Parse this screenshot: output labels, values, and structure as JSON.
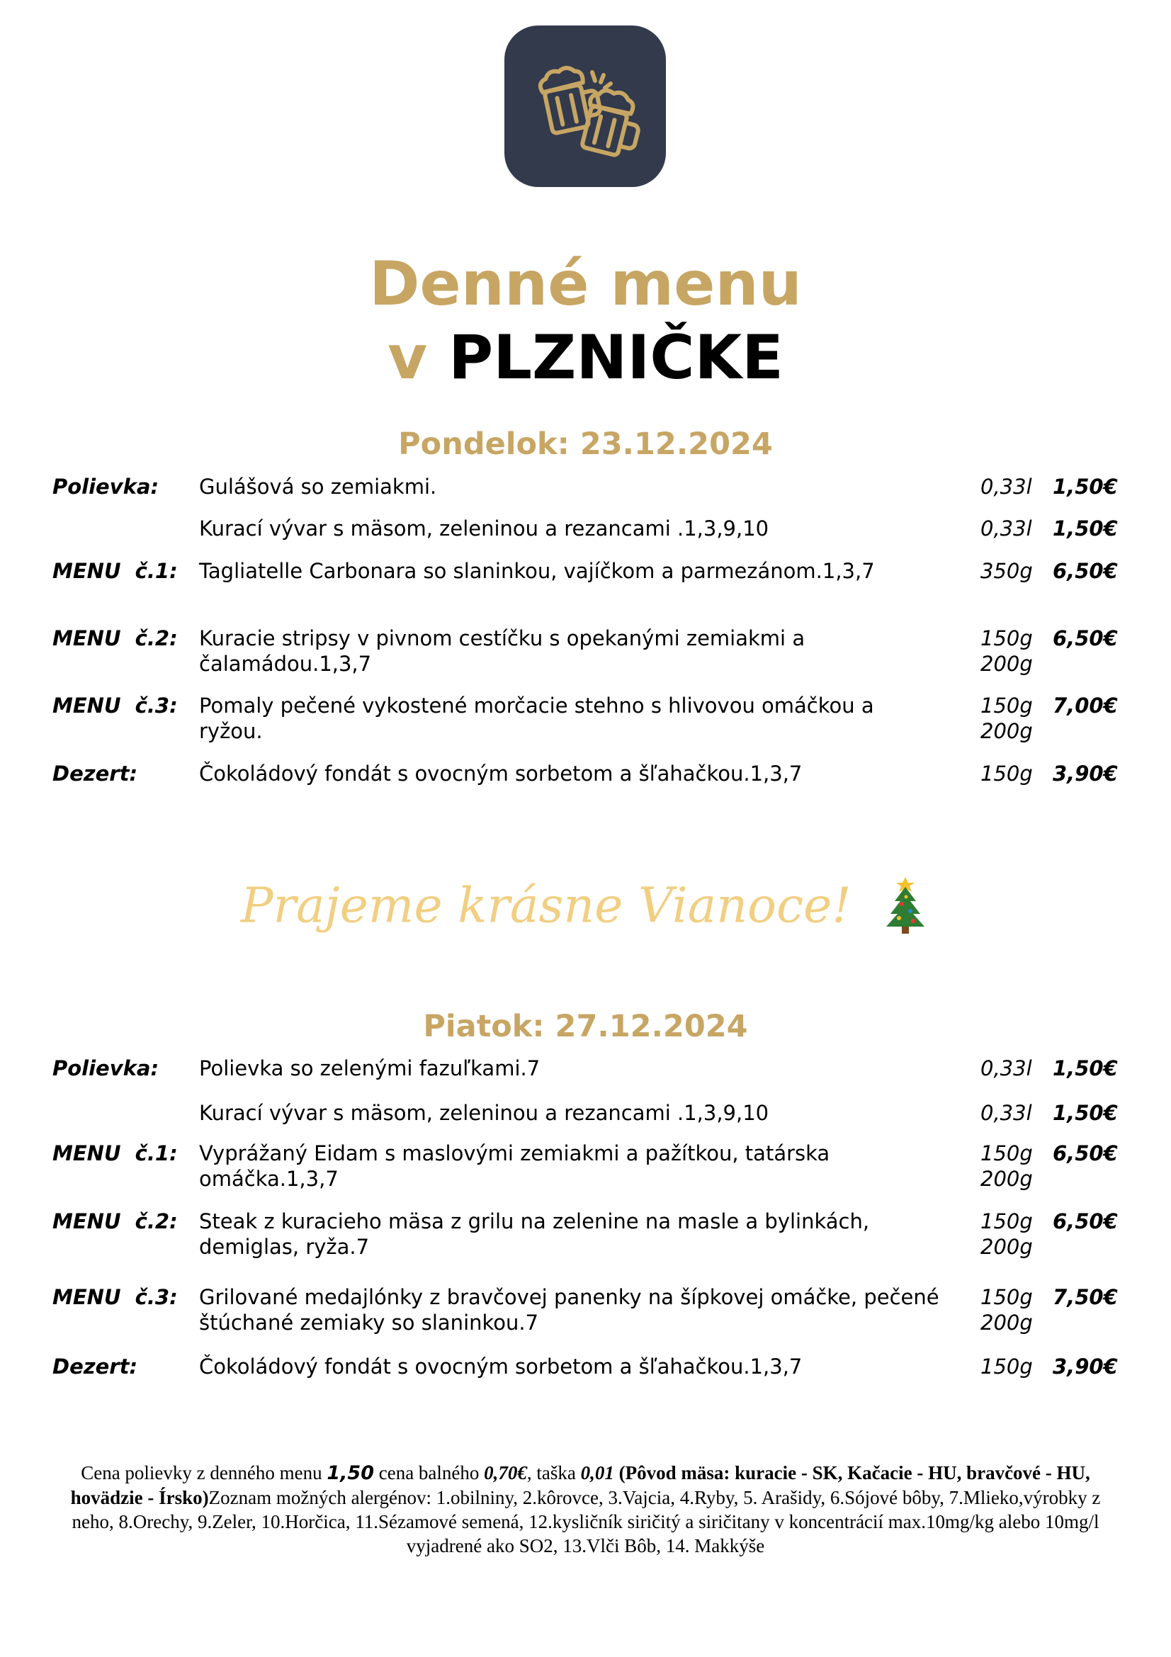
{
  "logo": {
    "icon": "beer-mugs-icon",
    "bg_color": "#323a4c",
    "icon_color": "#c7a664"
  },
  "title": {
    "line1": "Denné menu",
    "prefix": "v",
    "name": "PLZNIČKE"
  },
  "days": [
    {
      "heading": "Pondelok: 23.12.2024",
      "items": [
        {
          "label": "Polievka:",
          "desc": "Gulášová so zemiakmi.",
          "weight": "0,33l",
          "price": "1,50€"
        },
        {
          "label": "",
          "desc": "Kurací vývar s mäsom, zeleninou a rezancami .1,3,9,10",
          "weight": "0,33l",
          "price": "1,50€"
        },
        {
          "label": "MENU  č.1:",
          "desc": "Tagliatelle Carbonara so slaninkou, vajíčkom a parmezánom.1,3,7",
          "weight": "350g",
          "price": "6,50€"
        },
        {
          "label": "MENU  č.2:",
          "desc": "Kuracie stripsy v pivnom cestíčku s opekanými zemiakmi a čalamádou.1,3,7",
          "weight": "150g\n200g",
          "price": "6,50€"
        },
        {
          "label": "MENU  č.3:",
          "desc": "Pomaly pečené vykostené morčacie stehno s hlivovou omáčkou a ryžou.",
          "weight": "150g\n200g",
          "price": "7,00€"
        },
        {
          "label": "Dezert:",
          "desc": "Čokoládový fondát s ovocným sorbetom a šľahačkou.1,3,7",
          "weight": "150g",
          "price": "3,90€"
        }
      ]
    },
    {
      "heading": "Piatok: 27.12.2024",
      "items": [
        {
          "label": "Polievka:",
          "desc": "Polievka so zelenými fazuľkami.7",
          "weight": "0,33l",
          "price": "1,50€"
        },
        {
          "label": "",
          "desc": "Kurací vývar s mäsom, zeleninou a rezancami .1,3,9,10",
          "weight": "0,33l",
          "price": "1,50€"
        },
        {
          "label": "MENU  č.1:",
          "desc": "Vyprážaný Eidam s maslovými zemiakmi a pažítkou, tatárska omáčka.1,3,7",
          "weight": "150g\n200g",
          "price": "6,50€"
        },
        {
          "label": "MENU  č.2:",
          "desc": "Steak z kuracieho mäsa z grilu na  zelenine na masle a bylinkách, demiglas, ryža.7",
          "weight": "150g\n200g",
          "price": "6,50€"
        },
        {
          "label": "MENU  č.3:",
          "desc": "Grilované medajlónky z bravčovej panenky na šípkovej omáčke, pečené štúchané zemiaky so slaninkou.7",
          "weight": "150g\n200g",
          "price": "7,50€"
        },
        {
          "label": "Dezert:",
          "desc": "Čokoládový fondát s ovocným sorbetom a šľahačkou.1,3,7",
          "weight": "150g",
          "price": "3,90€"
        }
      ]
    }
  ],
  "wishes": {
    "text": "Prajeme krásne Vianoce!",
    "icon": "christmas-tree-icon"
  },
  "footer": {
    "t1": "Cena polievky z denného menu ",
    "soup_price": "1,50",
    "t2": "  cena balného ",
    "pack_price": "0,70€",
    "t3": ", taška ",
    "bag_price": "0,01",
    "origin": "  (Pôvod mäsa: kuracie - SK, Kačacie -  HU, bravčové - HU, hovädzie - Írsko)",
    "allergens": "Zoznam možných alergénov: 1.obilniny, 2.kôrovce, 3.Vajcia, 4.Ryby, 5. Arašidy, 6.Sójové bôby, 7.Mlieko,výrobky z neho, 8.Orechy, 9.Zeler, 10.Horčica, 11.Sézamové semená, 12.kysličník siričitý a siričitany v koncentrácií max.10mg/kg alebo 10mg/l vyjadrené ako SO2, 13.Vlči Bôb, 14. Makkýše"
  }
}
